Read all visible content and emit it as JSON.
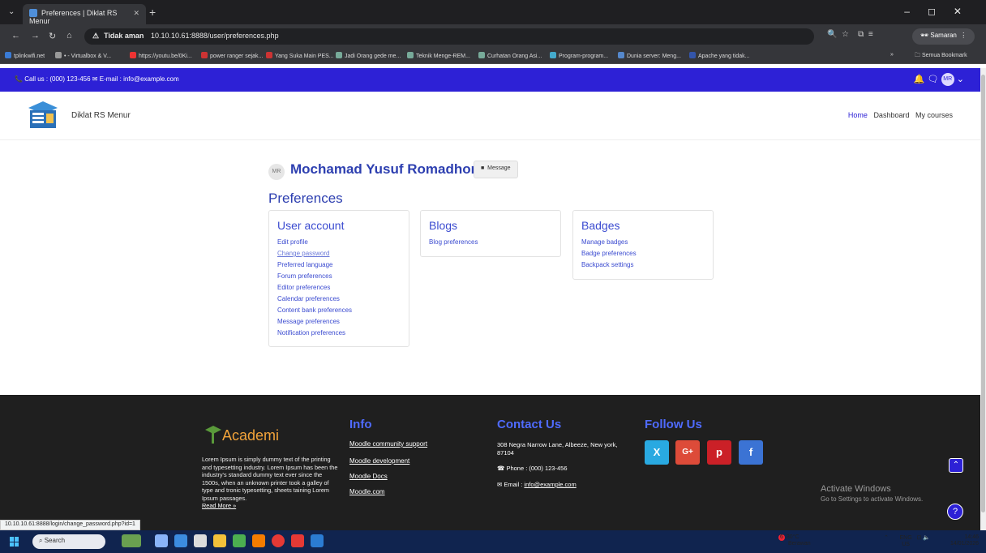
{
  "browser": {
    "tab_title": "Preferences | Diklat RS Menur",
    "security_label": "Tidak aman",
    "url": "10.10.10.61:8888/user/preferences.php",
    "incognito_label": "Samaran",
    "bookmarks": [
      "tplinkwifi.net",
      "• - Virtualbox & V...",
      "https://youtu.be/0Ki...",
      "power ranger sejak...",
      "Yang Suka Main PES...",
      "Jadi Orang gede me...",
      "Teknik Menge-REM...",
      "Curhatan Orang Asi...",
      "Program-program...",
      "Dunia server: Meng...",
      "Apache yang tidak..."
    ],
    "all_bookmarks_label": "Semua Bookmark",
    "status_url": "10.10.10.61:8888/login/change_password.php?id=1"
  },
  "topbar": {
    "contact": "Call us : (000) 123-456  ✉ E-mail : info@example.com",
    "avatar_initials": "MR"
  },
  "header": {
    "site_name": "Diklat RS Menur",
    "nav": [
      "Home",
      "Dashboard",
      "My courses"
    ]
  },
  "profile": {
    "initials": "MR",
    "name": "Mochamad Yusuf Romadhoni",
    "message_label": "Message"
  },
  "page_title": "Preferences",
  "cards": {
    "user_account": {
      "title": "User account",
      "links": [
        "Edit profile",
        "Change password",
        "Preferred language",
        "Forum preferences",
        "Editor preferences",
        "Calendar preferences",
        "Content bank preferences",
        "Message preferences",
        "Notification preferences"
      ]
    },
    "blogs": {
      "title": "Blogs",
      "links": [
        "Blog preferences"
      ]
    },
    "badges": {
      "title": "Badges",
      "links": [
        "Manage badges",
        "Badge preferences",
        "Backpack settings"
      ]
    }
  },
  "footer": {
    "brand": "Academi",
    "about": "Lorem Ipsum is simply dummy text of the printing and typesetting industry. Lorem Ipsum has been the industry's standard dummy text ever since the 1500s, when an unknown printer took a galley of type and tronic typesetting, sheets taining Lorem Ipsum passages.",
    "read_more": "Read More »",
    "info_title": "Info",
    "info_links": [
      "Moodle community support",
      "Moodle development",
      "Moodle Docs",
      "Moodle.com"
    ],
    "contact_title": "Contact Us",
    "address": "308 Negra Narrow Lane, Albeeze, New york, 87104",
    "phone": "Phone : (000) 123-456",
    "email_label": "Email : ",
    "email": "info@example.com",
    "follow_title": "Follow Us"
  },
  "windows": {
    "activate_title": "Activate Windows",
    "activate_sub": "Go to Settings to activate Windows.",
    "search_placeholder": "Search",
    "weather_temp": "30°C",
    "weather_desc": "Berawan",
    "weather_badge": "6",
    "lang": "ENG",
    "region": "US",
    "time": "14:46",
    "date": "14/01/2026"
  },
  "colors": {
    "brand_blue": "#2d21d6",
    "link_blue": "#3b4bd0",
    "footer_bg": "#1f1f1f",
    "academi_orange": "#f2a33a"
  }
}
